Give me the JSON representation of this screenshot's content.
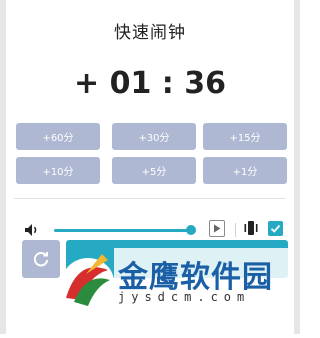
{
  "dialog": {
    "title": "快速闹钟",
    "time": "+ 01 : 36"
  },
  "presets": [
    {
      "label": "+60分"
    },
    {
      "label": "+30分"
    },
    {
      "label": "+15分"
    },
    {
      "label": "+10分"
    },
    {
      "label": "+5分"
    },
    {
      "label": "+1分"
    }
  ],
  "controls": {
    "volume_level": 0.97,
    "vibrate_checked": true,
    "accent_color": "#26a9c2",
    "preset_color": "#aeb8d2",
    "icons": {
      "volume": "speaker-icon",
      "play": "play-icon",
      "vibrate": "vibrate-icon",
      "check": "check-icon",
      "reset": "refresh-icon"
    }
  },
  "watermark": {
    "name": "金鹰软件园",
    "url": "jysdcm.com"
  }
}
